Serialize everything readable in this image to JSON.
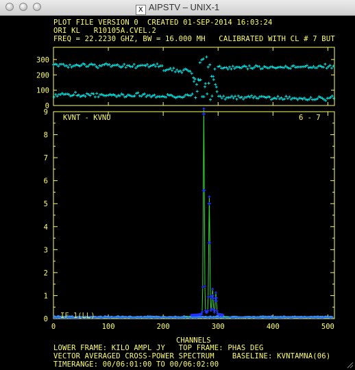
{
  "window": {
    "title": "AIPSTV – UNIX-1"
  },
  "header": {
    "line1": "PLOT FILE VERSION 0  CREATED 01-SEP-2014 16:03:24",
    "line2": "ORI KL   R10105A.CVEL.2",
    "line3": "FREQ = 22.2230 GHZ, BW = 16.000 MH   CALIBRATED WITH CL # 7 BUT"
  },
  "footer": {
    "line1": "LOWER FRAME: KILO AMPL JY   TOP FRAME: PHAS DEG",
    "line2": "VECTOR AVERAGED CROSS-POWER SPECTRUM    BASELINE: KVNTAMNA(06)",
    "line3": "TIMERANGE: 00/06:01:00 TO 00/06:02:00"
  },
  "panel": {
    "baseline_label": "KVNT - KVNU",
    "antenna_label": "6 - 7",
    "if_label": "IF 1(LL)"
  },
  "colors": {
    "frame": "#ffff66",
    "phase_marker": "#00e5e5",
    "amp_line": "#33dd33",
    "amp_marker": "#2233ff",
    "noise": "#3aa0ff"
  },
  "chart_data": [
    {
      "type": "scatter",
      "name": "phase",
      "ylabel": "PHAS DEG",
      "xlim": [
        0,
        512
      ],
      "ylim": [
        0,
        380
      ],
      "yticks": [
        "0",
        "100",
        "200",
        "300"
      ],
      "upper_band_mean": 250,
      "lower_band_mean": 75
    },
    {
      "type": "line",
      "name": "amplitude",
      "xlabel": "CHANNELS",
      "ylabel": "KILO AMPL JY",
      "xlim": [
        0,
        512
      ],
      "ylim": [
        0,
        9
      ],
      "xticks": [
        "0",
        "100",
        "200",
        "300",
        "400",
        "500"
      ],
      "yticks": [
        "0",
        "1",
        "2",
        "3",
        "4",
        "5",
        "6",
        "7",
        "8",
        "9"
      ],
      "peaks": [
        {
          "x": 274,
          "y": 8.9
        },
        {
          "x": 284,
          "y": 5.0
        },
        {
          "x": 290,
          "y": 1.0
        },
        {
          "x": 296,
          "y": 0.9
        }
      ]
    }
  ]
}
